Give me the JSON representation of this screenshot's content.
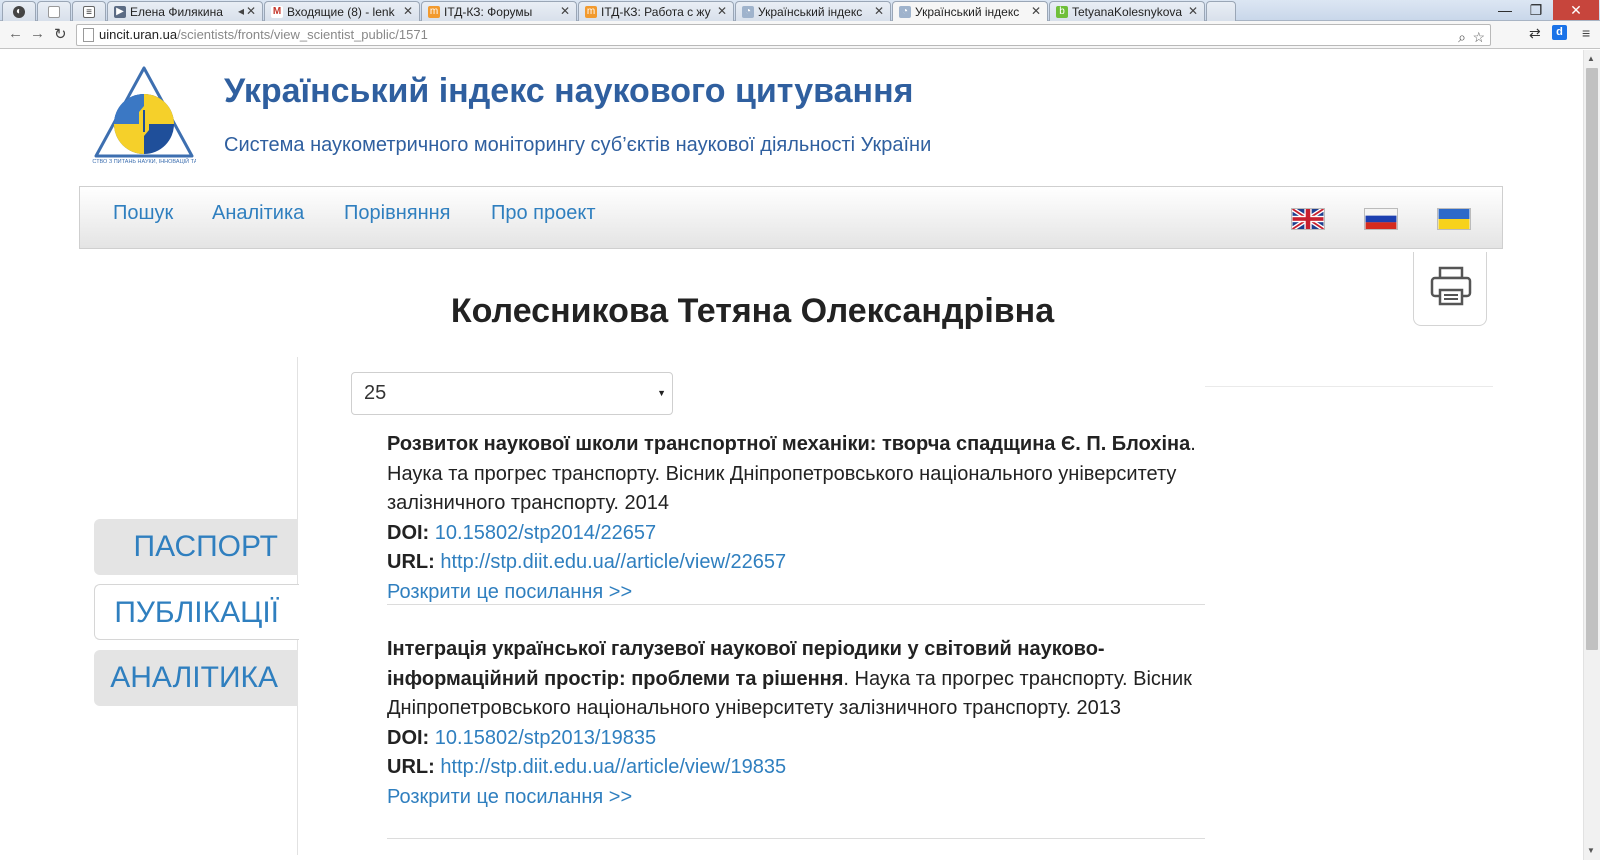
{
  "browser": {
    "tabs": [
      {
        "title": "",
        "icon": "incognito-icon"
      },
      {
        "title": "",
        "icon": "blank-page-icon"
      },
      {
        "title": "",
        "icon": "reader-icon"
      },
      {
        "title": "Елена Филякина",
        "icon": "video-icon",
        "extra": "◂"
      },
      {
        "title": "Входящие (8) - lenk",
        "icon": "gmail-icon"
      },
      {
        "title": "ІТД-КЗ: Форумы",
        "icon": "moodle-icon"
      },
      {
        "title": "ІТД-КЗ: Работа с жу",
        "icon": "moodle-icon"
      },
      {
        "title": "Український індекс",
        "icon": "uncit-icon"
      },
      {
        "title": "Український індекс",
        "icon": "uncit-icon",
        "active": true
      },
      {
        "title": "TetyanaKolesnykova",
        "icon": "researchgate-icon"
      }
    ],
    "url_host": "uincit.uran.ua",
    "url_path": "/scientists/fronts/view_scientist_public/1571"
  },
  "site": {
    "title": "Український індекс наукового цитування",
    "subtitle": "Система наукометричного моніторингу суб’єктів наукової діяльності України",
    "logo_ring_text": "ДЕРЖАВНЕ АГЕНТСТВО З ПИТАНЬ НАУКИ, ІННОВАЦІЙ ТА ІНФОРМАТИЗАЦІЇ"
  },
  "nav": {
    "links": [
      "Пошук",
      "Аналітика",
      "Порівняння",
      "Про проект"
    ],
    "languages": [
      "en",
      "ru",
      "uk"
    ]
  },
  "profile": {
    "name": "Колесникова Тетяна Олександрівна"
  },
  "sidebar": {
    "tabs": [
      {
        "label": "ПАСПОРТ",
        "active": false
      },
      {
        "label": "ПУБЛІКАЦІЇ",
        "active": true
      },
      {
        "label": "АНАЛІТИКА",
        "active": false
      }
    ]
  },
  "publications": {
    "per_page": "25",
    "doi_label": "DOI:",
    "url_label": "URL:",
    "expand_label": "Розкрити це посилання >>",
    "items": [
      {
        "title": "Розвиток наукової школи транспортної механіки: творча спадщина Є. П. Блохіна",
        "source": ". Наука та прогрес транспорту. Вісник Дніпропетровського національного університету залізничного транспорту. 2014",
        "doi": "10.15802/stp2014/22657",
        "url": "http://stp.diit.edu.ua//article/view/22657"
      },
      {
        "title": "Інтеграція української галузевої наукової періодики у світовий науково-інформаційний простір: проблеми та рішення",
        "source": ". Наука та прогрес транспорту. Вісник Дніпропетровського національного університету залізничного транспорту. 2013",
        "doi": "10.15802/stp2013/19835",
        "url": "http://stp.diit.edu.ua//article/view/19835"
      }
    ]
  },
  "colors": {
    "link": "#2f7fbf",
    "title": "#2f5f9f",
    "tab_inactive": "#e4e4e4"
  }
}
